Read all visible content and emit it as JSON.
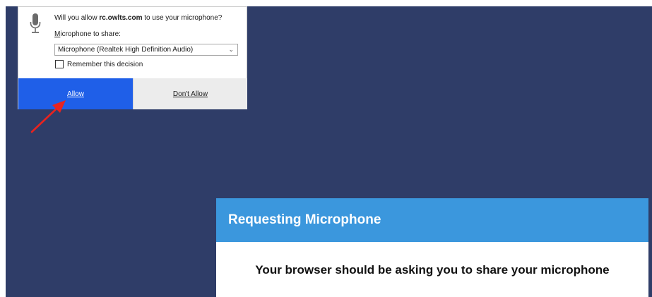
{
  "popup": {
    "question_prefix": "Will you allow ",
    "site": "rc.owlts.com",
    "question_suffix": " to use your microphone?",
    "share_label_first": "M",
    "share_label_rest": "icrophone to share:",
    "device_selected": "Microphone (Realtek High Definition Audio)",
    "remember_label": "Remember this decision",
    "remember_checked": false,
    "allow_label": "Allow",
    "deny_label": "Don't Allow",
    "icons": {
      "mic": "microphone-icon",
      "dropdown": "chevron-down-icon"
    },
    "colors": {
      "allow_bg": "#1f5fe8",
      "deny_bg": "#ececec"
    }
  },
  "annotation": {
    "icon": "red-arrow-icon",
    "color": "#e8231f"
  },
  "card": {
    "title": "Requesting Microphone",
    "message": "Your browser should be asking you to share your microphone",
    "colors": {
      "header_bg": "#3b97dd",
      "page_bg": "#2f3d68"
    }
  }
}
